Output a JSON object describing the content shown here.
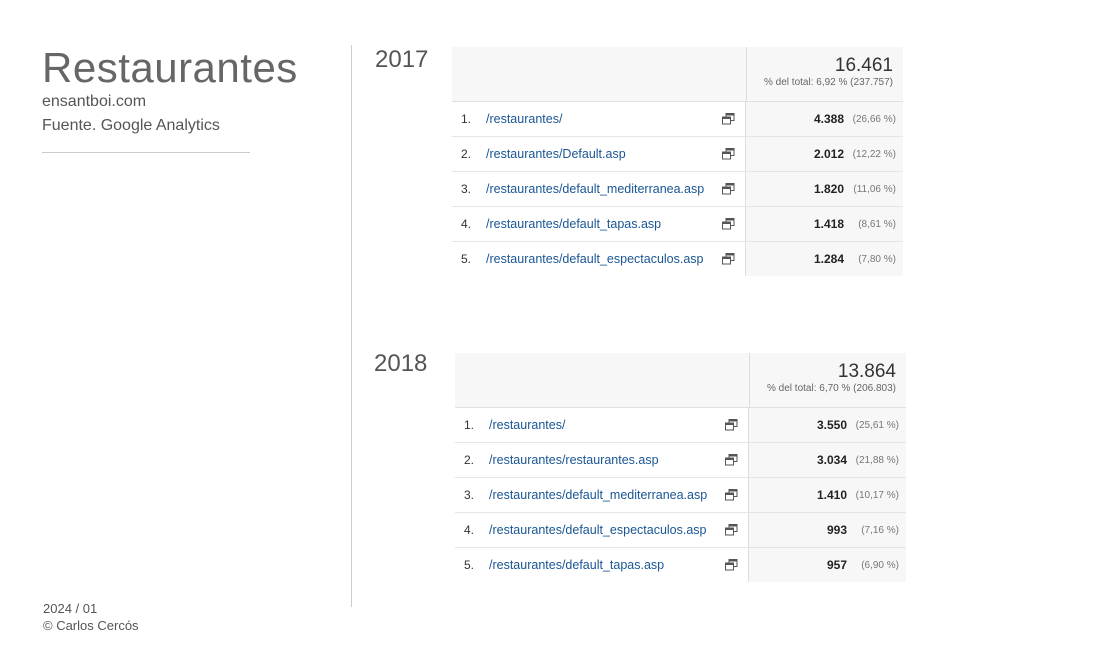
{
  "header": {
    "title": "Restaurantes",
    "subtitle": "ensantboi.com",
    "source": "Fuente. Google Analytics"
  },
  "footer": {
    "date": "2024 / 01",
    "author": "© Carlos Cercós"
  },
  "tables": [
    {
      "year": "2017",
      "total": "16.461",
      "total_pct": "% del total: 6,92 % (237.757)",
      "rows": [
        {
          "rank": "1.",
          "page": "/restaurantes/",
          "value": "4.388",
          "pct": "(26,66 %)"
        },
        {
          "rank": "2.",
          "page": "/restaurantes/Default.asp",
          "value": "2.012",
          "pct": "(12,22 %)"
        },
        {
          "rank": "3.",
          "page": "/restaurantes/default_mediterranea.asp",
          "value": "1.820",
          "pct": "(11,06 %)"
        },
        {
          "rank": "4.",
          "page": "/restaurantes/default_tapas.asp",
          "value": "1.418",
          "pct": "(8,61 %)"
        },
        {
          "rank": "5.",
          "page": "/restaurantes/default_espectaculos.asp",
          "value": "1.284",
          "pct": "(7,80 %)"
        }
      ]
    },
    {
      "year": "2018",
      "total": "13.864",
      "total_pct": "% del total: 6,70 % (206.803)",
      "rows": [
        {
          "rank": "1.",
          "page": "/restaurantes/",
          "value": "3.550",
          "pct": "(25,61 %)"
        },
        {
          "rank": "2.",
          "page": "/restaurantes/restaurantes.asp",
          "value": "3.034",
          "pct": "(21,88 %)"
        },
        {
          "rank": "3.",
          "page": "/restaurantes/default_mediterranea.asp",
          "value": "1.410",
          "pct": "(10,17 %)"
        },
        {
          "rank": "4.",
          "page": "/restaurantes/default_espectaculos.asp",
          "value": "993",
          "pct": "(7,16 %)"
        },
        {
          "rank": "5.",
          "page": "/restaurantes/default_tapas.asp",
          "value": "957",
          "pct": "(6,90 %)"
        }
      ]
    }
  ],
  "icons": {
    "row_action": "open-in-new-window-icon"
  }
}
